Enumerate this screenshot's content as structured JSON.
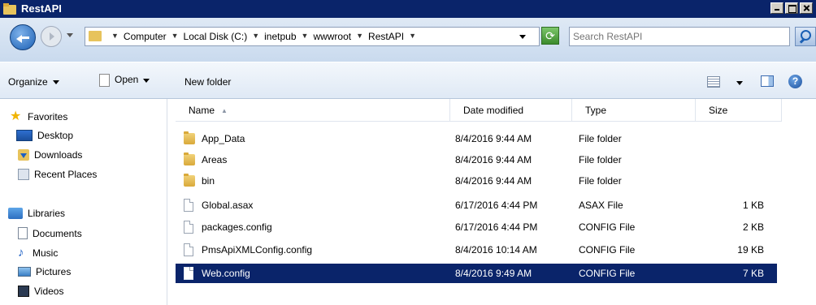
{
  "window": {
    "title": "RestAPI"
  },
  "address": {
    "crumbs": [
      "Computer",
      "Local Disk (C:)",
      "inetpub",
      "wwwroot",
      "RestAPI"
    ]
  },
  "search": {
    "placeholder": "Search RestAPI"
  },
  "toolbar": {
    "organize": "Organize",
    "open": "Open",
    "new_folder": "New folder"
  },
  "sidebar": {
    "favorites": "Favorites",
    "desktop": "Desktop",
    "downloads": "Downloads",
    "recent": "Recent Places",
    "libraries": "Libraries",
    "documents": "Documents",
    "music": "Music",
    "pictures": "Pictures",
    "videos": "Videos"
  },
  "columns": {
    "name": "Name",
    "date": "Date modified",
    "type": "Type",
    "size": "Size"
  },
  "files": [
    {
      "name": "App_Data",
      "date": "8/4/2016 9:44 AM",
      "type": "File folder",
      "size": "",
      "icon": "folder-icon"
    },
    {
      "name": "Areas",
      "date": "8/4/2016 9:44 AM",
      "type": "File folder",
      "size": "",
      "icon": "folder-icon"
    },
    {
      "name": "bin",
      "date": "8/4/2016 9:44 AM",
      "type": "File folder",
      "size": "",
      "icon": "folder-icon"
    },
    {
      "name": "Global.asax",
      "date": "6/17/2016 4:44 PM",
      "type": "ASAX File",
      "size": "1 KB",
      "icon": "file-icon"
    },
    {
      "name": "packages.config",
      "date": "6/17/2016 4:44 PM",
      "type": "CONFIG File",
      "size": "2 KB",
      "icon": "file-icon"
    },
    {
      "name": "PmsApiXMLConfig.config",
      "date": "8/4/2016 10:14 AM",
      "type": "CONFIG File",
      "size": "19 KB",
      "icon": "file-icon"
    },
    {
      "name": "Web.config",
      "date": "8/4/2016 9:49 AM",
      "type": "CONFIG File",
      "size": "7 KB",
      "icon": "file-icon",
      "selected": true
    }
  ],
  "colors": {
    "titlebar": "#0a246a",
    "selection": "#0a246a"
  }
}
